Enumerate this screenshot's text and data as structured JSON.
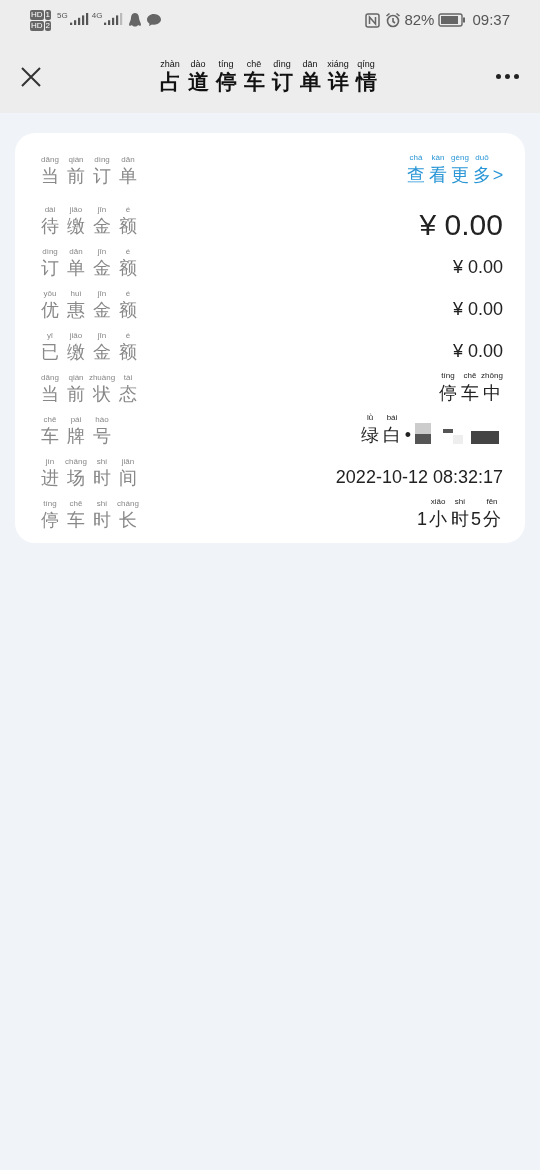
{
  "status_bar": {
    "sim_1": "HD",
    "sim_1_slot": "1",
    "sim_2": "HD",
    "sim_2_slot": "2",
    "network_1": "5G",
    "network_2": "4G",
    "battery": "82%",
    "time": "09:37"
  },
  "header": {
    "title": [
      {
        "t": "占",
        "py": "zhàn"
      },
      {
        "t": "道",
        "py": "dào"
      },
      {
        "t": "停",
        "py": "tíng"
      },
      {
        "t": "车",
        "py": "chē"
      },
      {
        "t": "订",
        "py": "dìng"
      },
      {
        "t": "单",
        "py": "dān"
      },
      {
        "t": "详",
        "py": "xiáng"
      },
      {
        "t": "情",
        "py": "qíng"
      }
    ]
  },
  "rows": [
    {
      "kind": "link",
      "label": [
        {
          "t": "当",
          "py": "dāng"
        },
        {
          "t": "前",
          "py": "qián"
        },
        {
          "t": "订",
          "py": "dìng"
        },
        {
          "t": "单",
          "py": "dān"
        }
      ],
      "value": [
        {
          "t": "查",
          "py": "chá"
        },
        {
          "t": "看",
          "py": "kàn"
        },
        {
          "t": "更",
          "py": "gèng"
        },
        {
          "t": "多",
          "py": "duō"
        },
        {
          "t": ">"
        }
      ]
    },
    {
      "kind": "large",
      "label": [
        {
          "t": "待",
          "py": "dài"
        },
        {
          "t": "缴",
          "py": "jiǎo"
        },
        {
          "t": "金",
          "py": "jīn"
        },
        {
          "t": "额",
          "py": "é"
        }
      ],
      "value": [
        {
          "t": "¥ 0.00"
        }
      ]
    },
    {
      "kind": "normal",
      "label": [
        {
          "t": "订",
          "py": "dìng"
        },
        {
          "t": "单",
          "py": "dān"
        },
        {
          "t": "金",
          "py": "jīn"
        },
        {
          "t": "额",
          "py": "é"
        }
      ],
      "value": [
        {
          "t": "¥ 0.00"
        }
      ]
    },
    {
      "kind": "normal",
      "label": [
        {
          "t": "优",
          "py": "yōu"
        },
        {
          "t": "惠",
          "py": "huì"
        },
        {
          "t": "金",
          "py": "jīn"
        },
        {
          "t": "额",
          "py": "é"
        }
      ],
      "value": [
        {
          "t": "¥ 0.00"
        }
      ]
    },
    {
      "kind": "normal",
      "label": [
        {
          "t": "已",
          "py": "yǐ"
        },
        {
          "t": "缴",
          "py": "jiǎo"
        },
        {
          "t": "金",
          "py": "jīn"
        },
        {
          "t": "额",
          "py": "é"
        }
      ],
      "value": [
        {
          "t": "¥ 0.00"
        }
      ]
    },
    {
      "kind": "normal",
      "label": [
        {
          "t": "当",
          "py": "dāng"
        },
        {
          "t": "前",
          "py": "qián"
        },
        {
          "t": "状",
          "py": "zhuàng"
        },
        {
          "t": "态",
          "py": "tài"
        }
      ],
      "value": [
        {
          "t": "停",
          "py": "tíng"
        },
        {
          "t": "车",
          "py": "chē"
        },
        {
          "t": "中",
          "py": "zhōng"
        }
      ]
    },
    {
      "kind": "plate",
      "label": [
        {
          "t": "车",
          "py": "chē"
        },
        {
          "t": "牌",
          "py": "pái"
        },
        {
          "t": "号",
          "py": "hào"
        }
      ],
      "value": [
        {
          "t": "绿",
          "py": "lǜ"
        },
        {
          "t": "白",
          "py": "bái"
        },
        {
          "t": "•"
        }
      ]
    },
    {
      "kind": "normal",
      "label": [
        {
          "t": "进",
          "py": "jìn"
        },
        {
          "t": "场",
          "py": "chǎng"
        },
        {
          "t": "时",
          "py": "shí"
        },
        {
          "t": "间",
          "py": "jiān"
        }
      ],
      "value": [
        {
          "t": "2022-10-12 08:32:17"
        }
      ]
    },
    {
      "kind": "normal",
      "label": [
        {
          "t": "停",
          "py": "tíng"
        },
        {
          "t": "车",
          "py": "chē"
        },
        {
          "t": "时",
          "py": "shí"
        },
        {
          "t": "长",
          "py": "cháng"
        }
      ],
      "value": [
        {
          "t": "1"
        },
        {
          "t": "小",
          "py": "xiǎo"
        },
        {
          "t": "时",
          "py": "shí"
        },
        {
          "t": "5"
        },
        {
          "t": "分",
          "py": "fēn"
        }
      ]
    }
  ]
}
